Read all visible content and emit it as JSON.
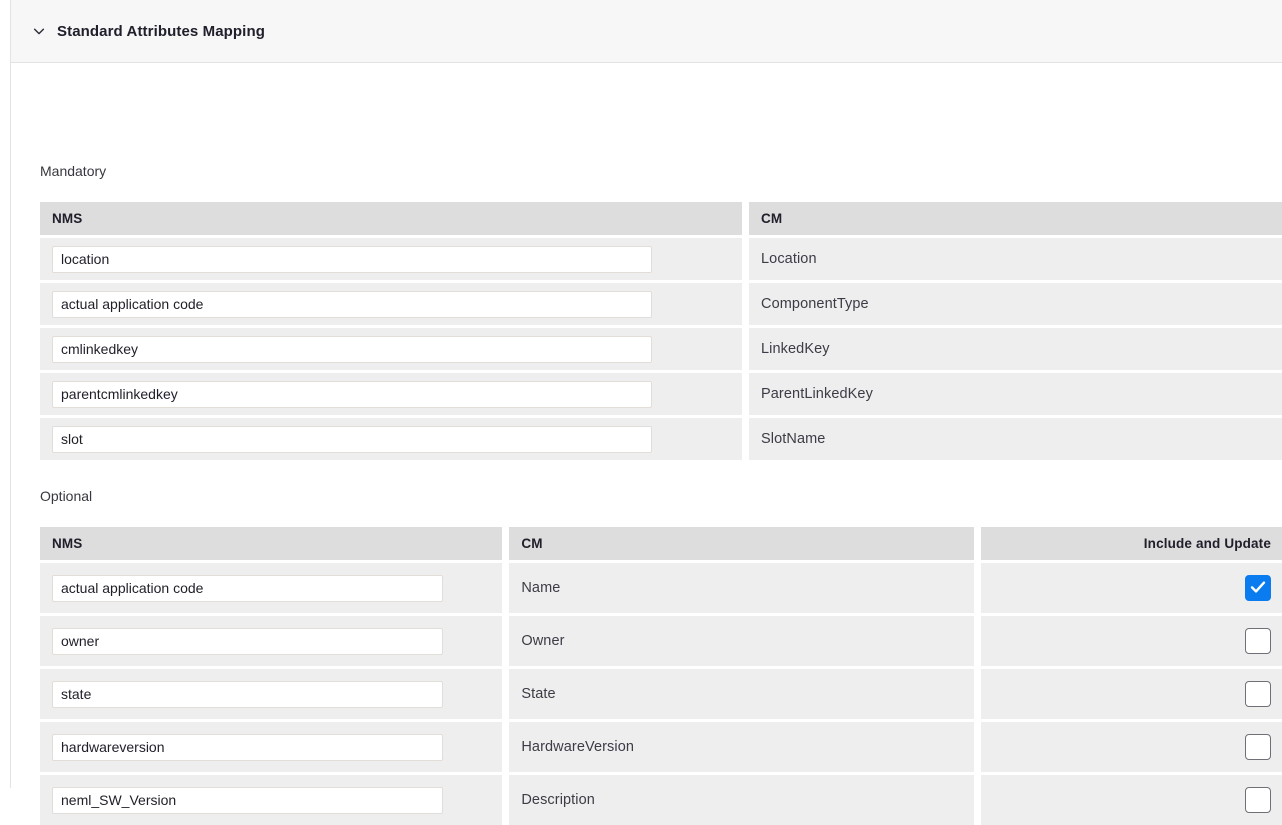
{
  "panel": {
    "title": "Standard Attributes Mapping",
    "collapse_icon": "chevron-down-icon",
    "expanded": true
  },
  "sections": {
    "mandatory": {
      "label": "Mandatory",
      "columns": [
        "NMS",
        "CM"
      ],
      "rows": [
        {
          "nms": "location",
          "cm": "Location"
        },
        {
          "nms": "actual application code",
          "cm": "ComponentType"
        },
        {
          "nms": "cmlinkedkey",
          "cm": "LinkedKey"
        },
        {
          "nms": "parentcmlinkedkey",
          "cm": "ParentLinkedKey"
        },
        {
          "nms": "slot",
          "cm": "SlotName"
        }
      ]
    },
    "optional": {
      "label": "Optional",
      "columns": [
        "NMS",
        "CM",
        "Include and Update"
      ],
      "rows": [
        {
          "nms": "actual application code",
          "cm": "Name",
          "include": true
        },
        {
          "nms": "owner",
          "cm": "Owner",
          "include": false
        },
        {
          "nms": "state",
          "cm": "State",
          "include": false
        },
        {
          "nms": "hardwareversion",
          "cm": "HardwareVersion",
          "include": false
        },
        {
          "nms": "neml_SW_Version",
          "cm": "Description",
          "include": false
        }
      ]
    }
  },
  "colors": {
    "header_band": "#f7f7f7",
    "column_header": "#dddddd",
    "row": "#eeeeee",
    "checkbox_checked": "#0a7cf0",
    "input_border": "#e2ddd7",
    "text": "#20202c"
  }
}
